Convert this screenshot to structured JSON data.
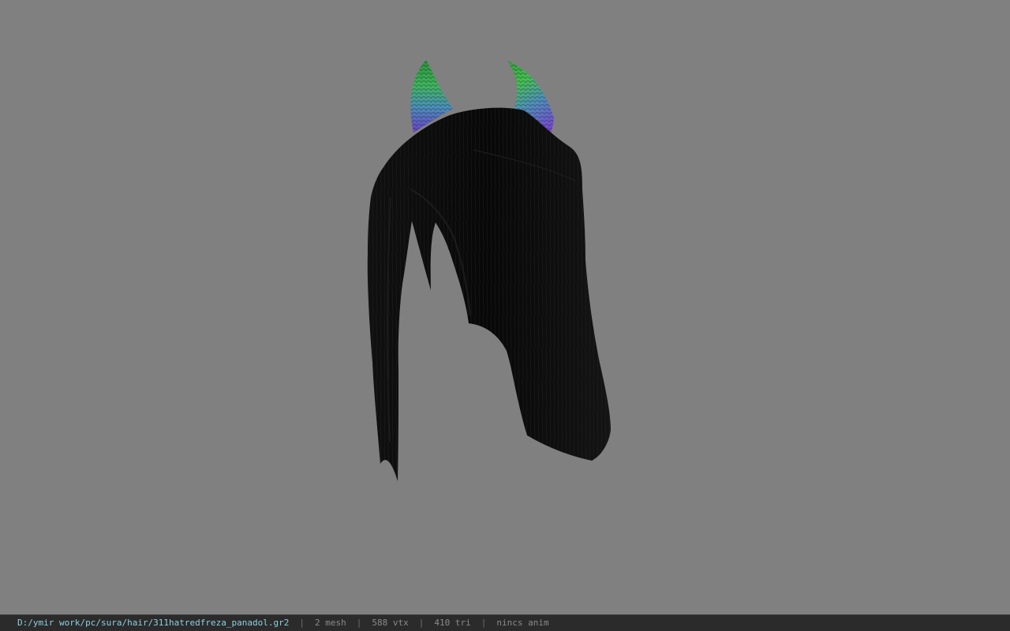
{
  "viewer": {
    "background_color": "#808080",
    "model": {
      "hair_color": "#0c0c0c",
      "horn_colors": [
        "#38c23c",
        "#4a8fb0",
        "#7b3fc9"
      ]
    }
  },
  "status": {
    "file_path": "D:/ymir work/pc/sura/hair/311hatredfreza_panadol.gr2",
    "separator": "|",
    "mesh": "2 mesh",
    "vertices": "588 vtx",
    "triangles": "410 tri",
    "anim": "nincs anim"
  }
}
